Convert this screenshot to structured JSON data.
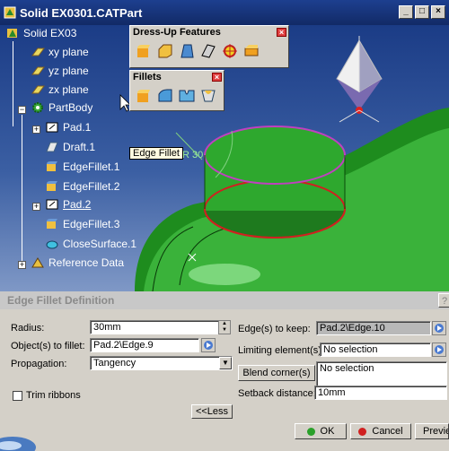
{
  "window": {
    "title": "Solid EX0301.CATPart",
    "buttons": {
      "minimize": "_",
      "maximize": "□",
      "close": "×"
    }
  },
  "tree": {
    "root": "Solid EX03",
    "planes": [
      "xy plane",
      "yz plane",
      "zx plane"
    ],
    "body": "PartBody",
    "features": [
      "Pad.1",
      "Draft.1",
      "EdgeFillet.1",
      "EdgeFillet.2",
      "Pad.2",
      "EdgeFillet.3",
      "CloseSurface.1"
    ],
    "reference": "Reference Data"
  },
  "toolbars": {
    "dressup": {
      "title": "Dress-Up Features"
    },
    "fillets": {
      "title": "Fillets"
    }
  },
  "tooltip": "Edge Fillet",
  "viewport": {
    "radius_label": "R 30"
  },
  "dialog": {
    "title": "Edge Fillet Definition",
    "help": "?",
    "radius_label": "Radius:",
    "radius_value": "30mm",
    "objects_label": "Object(s) to fillet:",
    "objects_value": "Pad.2\\Edge.9",
    "propagation_label": "Propagation:",
    "propagation_value": "Tangency",
    "trim_label": "Trim ribbons",
    "less_button": "<<Less",
    "keep_label": "Edge(s) to keep:",
    "keep_value": "Pad.2\\Edge.10",
    "limiting_label": "Limiting element(s):",
    "limiting_value": "No selection",
    "blend_button": "Blend corner(s)",
    "blend_value": "No selection",
    "setback_label": "Setback distance:",
    "setback_value": "10mm",
    "ok": "OK",
    "cancel": "Cancel",
    "preview": "Previe"
  },
  "colors": {
    "part_green": "#1e8c1e",
    "title_blue": "#1d3f8f",
    "highlight_magenta": "#c040c0",
    "edge_red": "#d02020"
  }
}
